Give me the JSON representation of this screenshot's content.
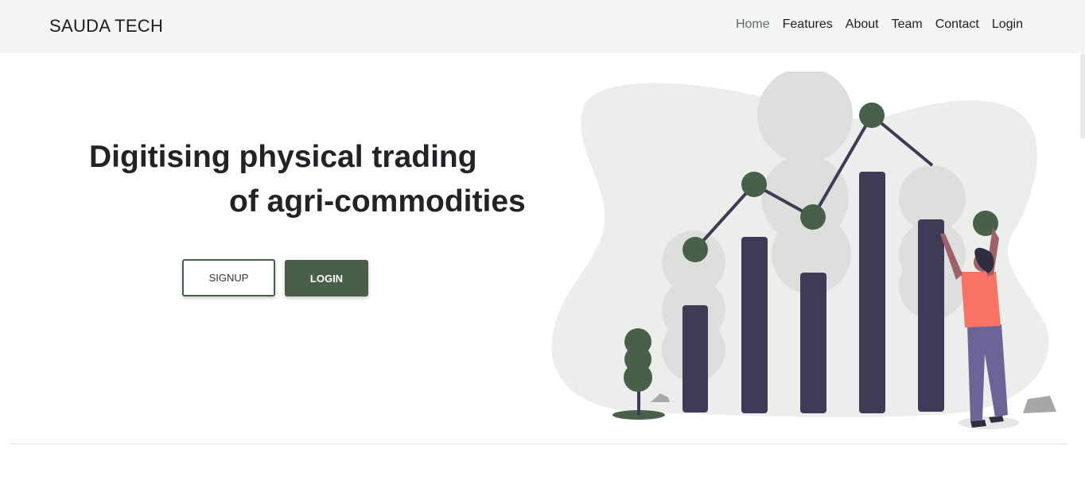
{
  "navbar": {
    "brand": "SAUDA TECH",
    "links": [
      {
        "label": "Home",
        "active": true
      },
      {
        "label": "Features",
        "active": false
      },
      {
        "label": "About",
        "active": false
      },
      {
        "label": "Team",
        "active": false
      },
      {
        "label": "Contact",
        "active": false
      },
      {
        "label": "Login",
        "active": false
      }
    ]
  },
  "hero": {
    "headline_line1": "Digitising physical trading",
    "headline_line2": "of agri-commodities",
    "signup_label": "SIGNUP",
    "login_label": "LOGIN"
  },
  "colors": {
    "accent": "#4a5f49",
    "nav_active": "#5b6e5b",
    "navbar_bg": "#f3f4f6",
    "bar": "#3f3a56",
    "blob": "#eceeeb",
    "person_shirt": "#f87266",
    "person_pants": "#6b6497"
  }
}
